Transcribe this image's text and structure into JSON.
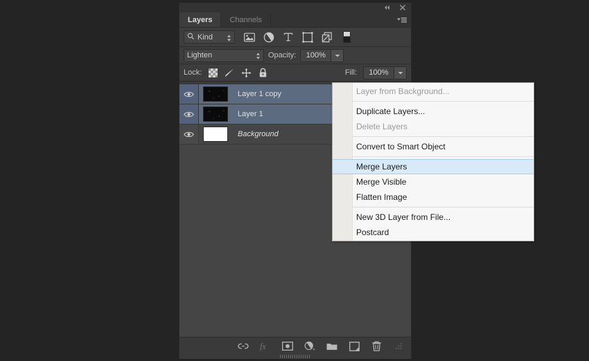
{
  "app": {
    "panel_title": "Layers",
    "background_color": "#242424",
    "panel_bg": "#3a3a3a",
    "list_bg": "#454545",
    "selected_row_color": "#5c6b80",
    "menu_highlight_color": "#d8eaf8"
  },
  "titlebar": {
    "collapse_label": "collapse-to-icons",
    "close_label": "close-panel"
  },
  "tabs": [
    {
      "label": "Layers",
      "active": true
    },
    {
      "label": "Channels",
      "active": false
    }
  ],
  "panel_menu": {
    "label": "panel-menu"
  },
  "filter_row": {
    "kind_label": "Kind",
    "search_icon": "search-icon",
    "icons": [
      {
        "name": "filter-pixel-layers-icon"
      },
      {
        "name": "filter-adjustment-layers-icon"
      },
      {
        "name": "filter-type-layers-icon"
      },
      {
        "name": "filter-shape-layers-icon"
      },
      {
        "name": "filter-smart-object-layers-icon"
      }
    ],
    "toggle_name": "filter-enable-toggle"
  },
  "blend_row": {
    "blend_mode": "Lighten",
    "opacity_label": "Opacity:",
    "opacity_value": "100%"
  },
  "lock_row": {
    "lock_label": "Lock:",
    "lock_icons": [
      {
        "name": "lock-transparent-pixels-icon"
      },
      {
        "name": "lock-image-pixels-icon"
      },
      {
        "name": "lock-position-icon"
      },
      {
        "name": "lock-all-icon"
      }
    ],
    "fill_label": "Fill:",
    "fill_value": "100%"
  },
  "layers": [
    {
      "name": "Layer 1 copy",
      "selected": true,
      "visible": true,
      "thumb": "dark",
      "italic": false
    },
    {
      "name": "Layer 1",
      "selected": true,
      "visible": true,
      "thumb": "dark",
      "italic": false
    },
    {
      "name": "Background",
      "selected": false,
      "visible": true,
      "thumb": "white",
      "italic": true
    }
  ],
  "bottom_toolbar": [
    {
      "name": "link-layers-icon",
      "disabled": false
    },
    {
      "name": "layer-style-fx-icon",
      "disabled": true
    },
    {
      "name": "add-layer-mask-icon",
      "disabled": false
    },
    {
      "name": "new-adjustment-layer-icon",
      "disabled": false
    },
    {
      "name": "new-group-icon",
      "disabled": false
    },
    {
      "name": "new-layer-icon",
      "disabled": false
    },
    {
      "name": "delete-layer-icon",
      "disabled": false
    }
  ],
  "context_menu": [
    {
      "label": "Layer from Background...",
      "state": "disabled"
    },
    {
      "type": "separator"
    },
    {
      "label": "Duplicate Layers...",
      "state": "normal"
    },
    {
      "label": "Delete Layers",
      "state": "disabled"
    },
    {
      "type": "separator"
    },
    {
      "label": "Convert to Smart Object",
      "state": "normal"
    },
    {
      "type": "separator"
    },
    {
      "label": "Merge Layers",
      "state": "highlight"
    },
    {
      "label": "Merge Visible",
      "state": "normal"
    },
    {
      "label": "Flatten Image",
      "state": "normal"
    },
    {
      "type": "separator"
    },
    {
      "label": "New 3D Layer from File...",
      "state": "normal"
    },
    {
      "label": "Postcard",
      "state": "normal"
    }
  ]
}
